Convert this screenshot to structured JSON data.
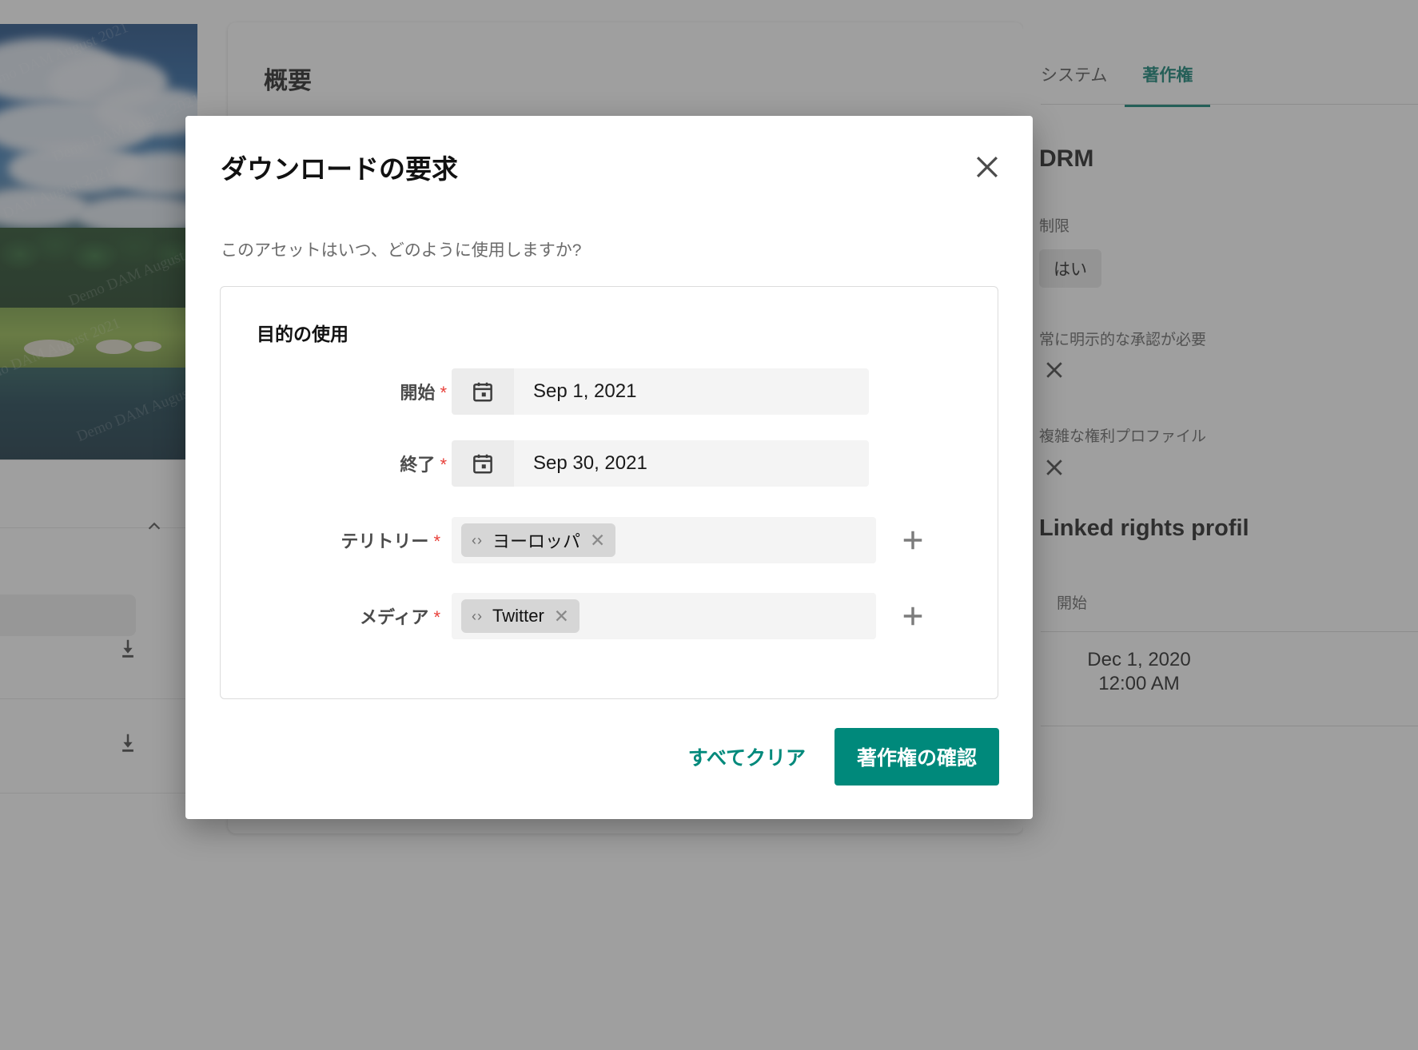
{
  "background": {
    "center_card_title": "概要",
    "asset_watermark": "Demo DAM August 2021",
    "right_panel": {
      "tabs": [
        {
          "label": "システム",
          "active": false
        },
        {
          "label": "著作権",
          "active": true
        }
      ],
      "drm_heading": "DRM",
      "restriction_label": "制限",
      "restriction_value": "はい",
      "explicit_approval_label": "常に明示的な承認が必要",
      "explicit_approval_value": "✕",
      "complex_rights_label": "複雑な権利プロファイル",
      "complex_rights_value": "✕",
      "linked_rights_heading": "Linked rights profil",
      "linked_start_label": "開始",
      "linked_start_date": "Dec 1, 2020",
      "linked_start_time": "12:00 AM"
    },
    "left_panel": {
      "collapse_icon": "chevron-up-icon",
      "download_icon": "download-icon"
    }
  },
  "modal": {
    "title": "ダウンロードの要求",
    "close_icon": "close-icon",
    "subtitle": "このアセットはいつ、どのように使用しますか?",
    "fieldset": {
      "legend": "目的の使用",
      "fields": [
        {
          "label": "開始",
          "required": "*",
          "type": "date",
          "icon": "calendar-icon",
          "value": "Sep 1, 2021"
        },
        {
          "label": "終了",
          "required": "*",
          "type": "date",
          "icon": "calendar-icon",
          "value": "Sep 30, 2021"
        },
        {
          "label": "テリトリー",
          "required": "*",
          "type": "tags",
          "tag_prefix": "‹›",
          "tag_value": "ヨーロッパ",
          "tag_remove": "✕",
          "add_icon": "plus-icon"
        },
        {
          "label": "メディア",
          "required": "*",
          "type": "tags",
          "tag_prefix": "‹›",
          "tag_value": "Twitter",
          "tag_remove": "✕",
          "add_icon": "plus-icon"
        }
      ]
    },
    "actions": {
      "clear_label": "すべてクリア",
      "confirm_label": "著作権の確認"
    }
  },
  "colors": {
    "accent": "#00897b",
    "accent_dark": "#00796b",
    "required": "#e8403a",
    "field_bg": "#f4f4f4",
    "tag_bg": "#d6d6d6"
  }
}
